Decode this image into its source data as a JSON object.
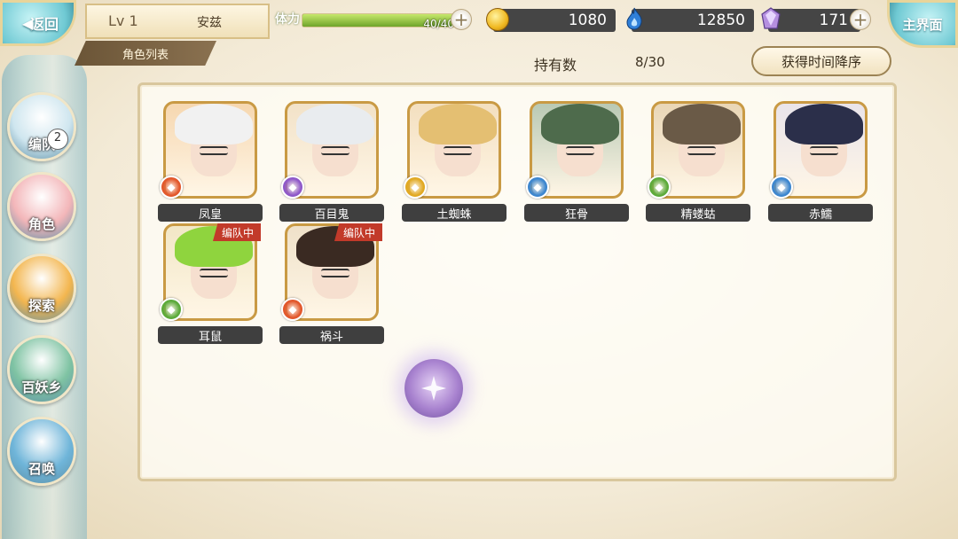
{
  "header": {
    "back_label": "返回",
    "level": "Lv 1",
    "player_name": "安兹",
    "page_title": "角色列表",
    "home_label": "主界面"
  },
  "resources": {
    "stamina_label": "体力",
    "stamina_value": "40/40",
    "stamina_fraction": 1.0,
    "coins": "1080",
    "souls": "12850",
    "gems": "171"
  },
  "list_info": {
    "owned_label": "持有数",
    "owned_value": "8/30",
    "sort_label": "获得时间降序"
  },
  "side_menu": [
    {
      "label": "编队",
      "badge": "2",
      "color": "#cfe6ef"
    },
    {
      "label": "角色",
      "badge": "",
      "color": "#f3b6b9"
    },
    {
      "label": "探索",
      "badge": "",
      "color": "#f3b64f"
    },
    {
      "label": "百妖乡",
      "badge": "",
      "color": "#7fc3a3"
    },
    {
      "label": "召唤",
      "badge": "",
      "color": "#6fb5d9"
    }
  ],
  "characters": [
    {
      "name": "凤皇",
      "element": "fire",
      "element_color": "#e2572b",
      "hair": "#f1f1f1",
      "bg": "#f6d7b0",
      "in_team": false
    },
    {
      "name": "百目鬼",
      "element": "spirit",
      "element_color": "#8e58c9",
      "hair": "#e9ecef",
      "bg": "#f2e2c8",
      "in_team": false
    },
    {
      "name": "土蜘蛛",
      "element": "earth",
      "element_color": "#e1a923",
      "hair": "#e4bf72",
      "bg": "#f3dfbf",
      "in_team": false
    },
    {
      "name": "狂骨",
      "element": "water",
      "element_color": "#3c86cf",
      "hair": "#4e6b4c",
      "bg": "#b9c9b4",
      "in_team": false
    },
    {
      "name": "精蝼蛄",
      "element": "wind",
      "element_color": "#5caa3a",
      "hair": "#6a5a47",
      "bg": "#e9d6b6",
      "in_team": false
    },
    {
      "name": "赤鱬",
      "element": "water",
      "element_color": "#3c86cf",
      "hair": "#2b2f4a",
      "bg": "#e9e4ea",
      "in_team": false
    },
    {
      "name": "耳鼠",
      "element": "wind",
      "element_color": "#5caa3a",
      "hair": "#8fd43e",
      "bg": "#f2e7c6",
      "in_team": true
    },
    {
      "name": "祸斗",
      "element": "fire",
      "element_color": "#e2572b",
      "hair": "#3a2a22",
      "bg": "#efe1c9",
      "in_team": true
    }
  ],
  "team_tag_label": "编队中"
}
